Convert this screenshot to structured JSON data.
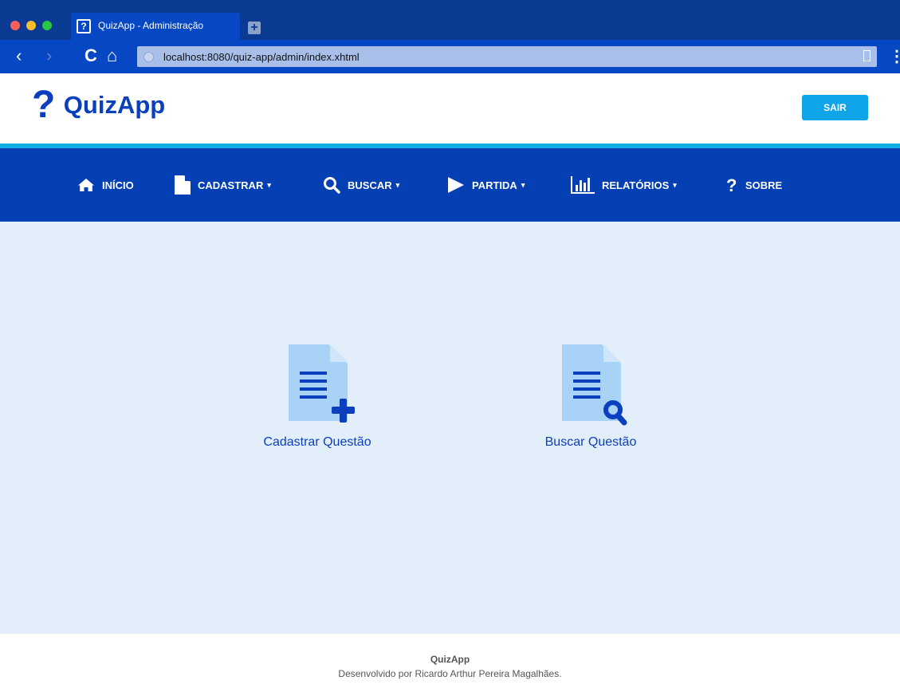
{
  "browser": {
    "tab_title": "QuizApp - Administração",
    "tab_favicon": "?",
    "new_tab": "+",
    "url": "localhost:8080/quiz-app/admin/index.xhtml",
    "nav_back": "‹",
    "nav_forward": "›",
    "reload": "C",
    "home": "⌂",
    "menu": "⋮"
  },
  "header": {
    "logo_mark": "?",
    "logo_text": "QuizApp",
    "logout_label": "SAIR"
  },
  "nav": {
    "items": [
      {
        "label": "INÍCIO",
        "icon": "home-icon",
        "caret": ""
      },
      {
        "label": "CADASTRAR",
        "icon": "document-icon",
        "caret": "▾"
      },
      {
        "label": "BUSCAR",
        "icon": "search-icon",
        "caret": "▾"
      },
      {
        "label": "PARTIDA",
        "icon": "play-icon",
        "caret": "▾"
      },
      {
        "label": "RELATÓRIOS",
        "icon": "bar-chart-icon",
        "caret": "▾"
      },
      {
        "label": "SOBRE",
        "icon": "question-icon",
        "caret": ""
      }
    ]
  },
  "main": {
    "actions": [
      {
        "label": "Cadastrar Questão",
        "icon": "document-add-icon"
      },
      {
        "label": "Buscar Questão",
        "icon": "document-search-icon"
      }
    ]
  },
  "footer": {
    "title": "QuizApp",
    "credit": "Desenvolvido por Ricardo Arthur Pereira Magalhães."
  },
  "colors": {
    "brand_blue": "#0b3fbd",
    "nav_blue": "#0440b4",
    "accent_cyan": "#11aee4",
    "content_bg": "#e2eefa",
    "doc_icon_light": "#a8d2f6"
  }
}
